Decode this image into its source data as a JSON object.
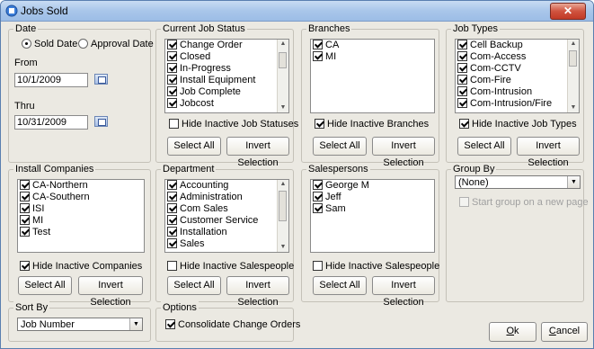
{
  "window": {
    "title": "Jobs Sold",
    "close_glyph": "✕"
  },
  "date": {
    "label": "Date",
    "sold_date": "Sold Date",
    "approval_date": "Approval Date",
    "from_label": "From",
    "from_value": "10/1/2009",
    "thru_label": "Thru",
    "thru_value": "10/31/2009"
  },
  "job_status": {
    "label": "Current Job Status",
    "items": [
      "Change Order",
      "Closed",
      "In-Progress",
      "Install Equipment",
      "Job Complete",
      "Jobcost"
    ],
    "hide_label": "Hide Inactive Job Statuses",
    "select_all": "Select All",
    "invert": "Invert Selection"
  },
  "branches": {
    "label": "Branches",
    "items": [
      "CA",
      "MI"
    ],
    "hide_label": "Hide Inactive Branches",
    "select_all": "Select All",
    "invert": "Invert Selection"
  },
  "job_types": {
    "label": "Job Types",
    "items": [
      "Cell Backup",
      "Com-Access",
      "Com-CCTV",
      "Com-Fire",
      "Com-Intrusion",
      "Com-Intrusion/Fire"
    ],
    "hide_label": "Hide Inactive Job Types",
    "select_all": "Select All",
    "invert": "Invert Selection"
  },
  "install_companies": {
    "label": "Install Companies",
    "items": [
      "CA-Northern",
      "CA-Southern",
      "ISI",
      "MI",
      "Test"
    ],
    "hide_label": "Hide Inactive Companies",
    "select_all": "Select All",
    "invert": "Invert Selection"
  },
  "department": {
    "label": "Department",
    "items": [
      "Accounting",
      "Administration",
      "Com Sales",
      "Customer Service",
      "Installation",
      "Sales"
    ],
    "hide_label": "Hide Inactive Salespeople",
    "select_all": "Select All",
    "invert": "Invert Selection"
  },
  "salespersons": {
    "label": "Salespersons",
    "items": [
      "George M",
      "Jeff",
      "Sam"
    ],
    "hide_label": "Hide Inactive Salespeople",
    "select_all": "Select All",
    "invert": "Invert Selection"
  },
  "group_by": {
    "label": "Group By",
    "value": "(None)",
    "new_page": "Start group on a new page"
  },
  "sort_by": {
    "label": "Sort By",
    "value": "Job Number"
  },
  "options": {
    "label": "Options",
    "consolidate": "Consolidate Change Orders"
  },
  "buttons": {
    "ok_key": "O",
    "ok_rest": "k",
    "cancel_key": "C",
    "cancel_rest": "ancel"
  },
  "colors": {
    "title_bar": "#a9c6ea",
    "close_button": "#c13a26",
    "dialog_bg": "#ebe9e2"
  }
}
